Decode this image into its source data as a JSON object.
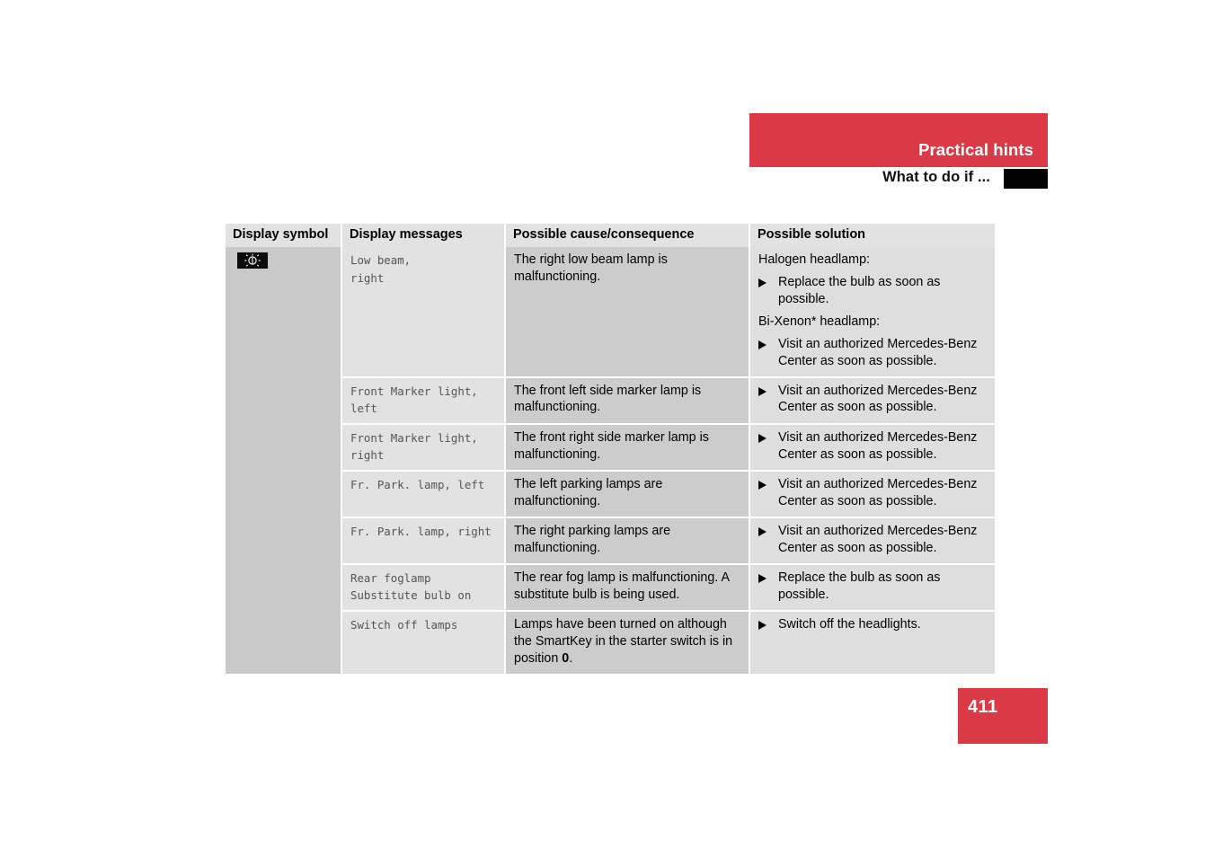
{
  "header": {
    "section_title": "Practical hints",
    "sub_title": "What to do if ...",
    "accent_color": "#d93a45",
    "tab_color": "#000000"
  },
  "table": {
    "columns": [
      {
        "key": "symbol",
        "label": "Display symbol"
      },
      {
        "key": "message",
        "label": "Display messages"
      },
      {
        "key": "cause",
        "label": "Possible cause/consequence"
      },
      {
        "key": "solution",
        "label": "Possible solution"
      }
    ],
    "symbol_cell": {
      "icon_name": "lamp-indicator-icon",
      "icon_description": "bulb with radiating rays on black background"
    },
    "rows": [
      {
        "message": "Low beam,\nright",
        "cause": "The right low beam lamp is malfunctioning.",
        "solution_blocks": [
          {
            "type": "label",
            "text": "Halogen headlamp:"
          },
          {
            "type": "bullet",
            "text": "Replace the bulb as soon as possible."
          },
          {
            "type": "label",
            "text": "Bi-Xenon* headlamp:"
          },
          {
            "type": "bullet",
            "text": "Visit an authorized Mercedes-Benz Center as soon as possible."
          }
        ]
      },
      {
        "message": "Front Marker light,\nleft",
        "cause": "The front left side marker lamp is malfunctioning.",
        "solution_blocks": [
          {
            "type": "bullet",
            "text": "Visit an authorized Mercedes-Benz Center as soon as possible."
          }
        ]
      },
      {
        "message": "Front Marker light,\nright",
        "cause": "The front right side marker lamp is malfunctioning.",
        "solution_blocks": [
          {
            "type": "bullet",
            "text": "Visit an authorized Mercedes-Benz Center as soon as possible."
          }
        ]
      },
      {
        "message": "Fr. Park. lamp, left",
        "cause": "The left parking lamps are malfunctioning.",
        "solution_blocks": [
          {
            "type": "bullet",
            "text": "Visit an authorized Mercedes-Benz Center as soon as possible."
          }
        ]
      },
      {
        "message": "Fr. Park. lamp, right",
        "cause": "The right parking lamps are malfunctioning.",
        "solution_blocks": [
          {
            "type": "bullet",
            "text": "Visit an authorized Mercedes-Benz Center as soon as possible."
          }
        ]
      },
      {
        "message": "Rear foglamp\nSubstitute bulb on",
        "cause": "The rear fog lamp is malfunctioning. A substitute bulb is being used.",
        "solution_blocks": [
          {
            "type": "bullet",
            "text": "Replace the bulb as soon as possible."
          }
        ]
      },
      {
        "message": "Switch off lamps",
        "cause_html": "Lamps have been turned on although the SmartKey in the starter switch is in position <b>0</b>.",
        "cause": "Lamps have been turned on although the SmartKey in the starter switch is in position 0.",
        "solution_blocks": [
          {
            "type": "bullet",
            "text": "Switch off the headlights."
          }
        ]
      }
    ]
  },
  "footer": {
    "page_number": "411"
  }
}
